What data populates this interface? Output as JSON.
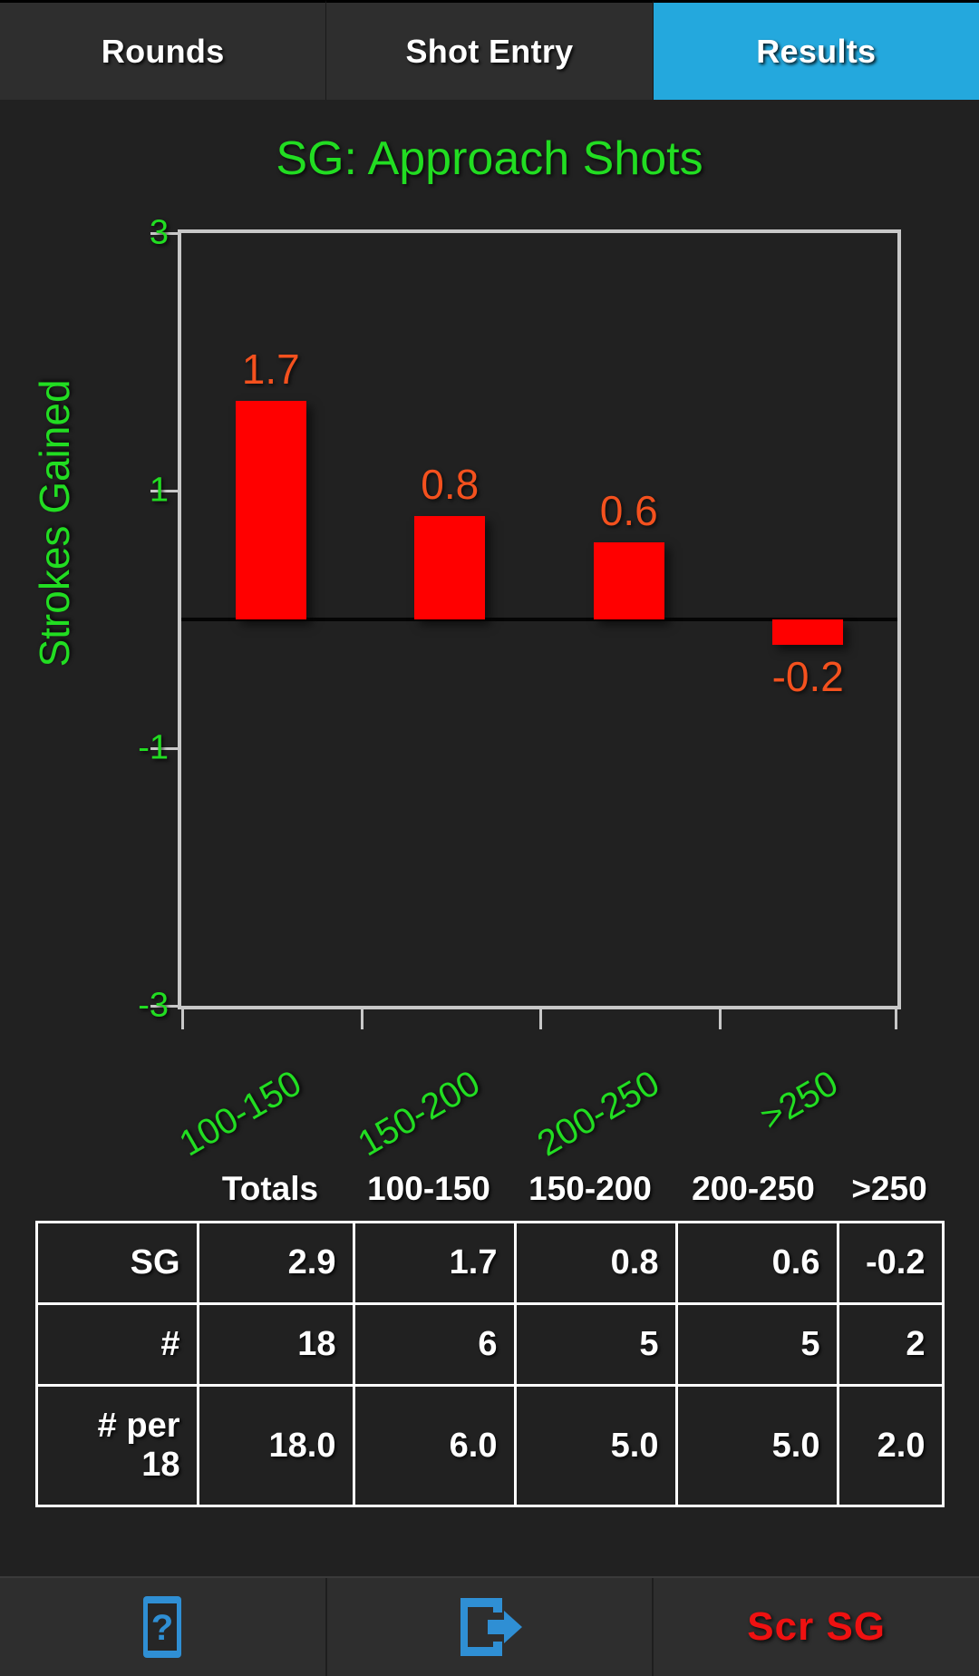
{
  "tabs": [
    {
      "label": "Rounds",
      "active": false
    },
    {
      "label": "Shot Entry",
      "active": false
    },
    {
      "label": "Results",
      "active": true
    }
  ],
  "colors": {
    "active_tab": "#24a8dd",
    "axis_green": "#22dd22",
    "bar_red": "#ff0000",
    "bar_label_orange": "#f4511e",
    "scr_sg_red": "#ee1111",
    "icon_blue": "#2f8fd4",
    "background": "#212121",
    "table_border": "#ffffff"
  },
  "chart_data": {
    "type": "bar",
    "title": "SG: Approach Shots",
    "xlabel": "",
    "ylabel": "Strokes Gained",
    "categories": [
      "100-150",
      "150-200",
      "200-250",
      ">250"
    ],
    "values": [
      1.7,
      0.8,
      0.6,
      -0.2
    ],
    "value_labels": [
      "1.7",
      "0.8",
      "0.6",
      "-0.2"
    ],
    "ylim": [
      -3,
      3
    ],
    "yticks": [
      3,
      1,
      -1,
      -3
    ],
    "ytick_labels": [
      "3",
      "1",
      "-1",
      "-3"
    ],
    "grid": false,
    "legend": "none",
    "zero_line": true,
    "xtick_rotation": -30
  },
  "table": {
    "headers": [
      "Totals",
      "100-150",
      "150-200",
      "200-250",
      ">250"
    ],
    "rows": [
      {
        "label": "SG",
        "cells": [
          "2.9",
          "1.7",
          "0.8",
          "0.6",
          "-0.2"
        ]
      },
      {
        "label": "#",
        "cells": [
          "18",
          "6",
          "5",
          "5",
          "2"
        ]
      },
      {
        "label": "# per 18",
        "cells": [
          "18.0",
          "6.0",
          "5.0",
          "5.0",
          "2.0"
        ]
      }
    ]
  },
  "bottombar": {
    "buttons": [
      {
        "icon": "help-phone-icon",
        "label": ""
      },
      {
        "icon": "exit-arrow-icon",
        "label": ""
      },
      {
        "icon": "",
        "label": "Scr SG"
      }
    ]
  }
}
